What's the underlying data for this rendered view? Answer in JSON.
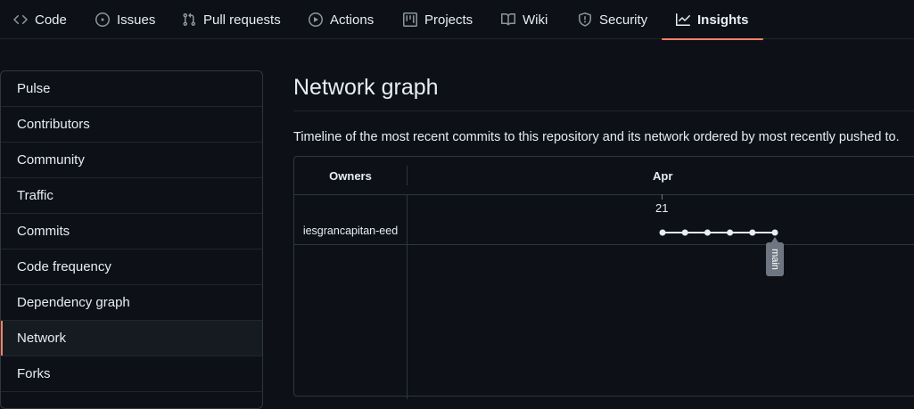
{
  "repo_nav": {
    "tabs": [
      {
        "label": "Code",
        "icon": "code-icon"
      },
      {
        "label": "Issues",
        "icon": "issue-icon"
      },
      {
        "label": "Pull requests",
        "icon": "pull-request-icon"
      },
      {
        "label": "Actions",
        "icon": "play-icon"
      },
      {
        "label": "Projects",
        "icon": "table-icon"
      },
      {
        "label": "Wiki",
        "icon": "book-icon"
      },
      {
        "label": "Security",
        "icon": "shield-icon"
      },
      {
        "label": "Insights",
        "icon": "graph-icon",
        "active": true
      }
    ]
  },
  "sidebar": {
    "items": [
      {
        "label": "Pulse"
      },
      {
        "label": "Contributors"
      },
      {
        "label": "Community"
      },
      {
        "label": "Traffic"
      },
      {
        "label": "Commits"
      },
      {
        "label": "Code frequency"
      },
      {
        "label": "Dependency graph"
      },
      {
        "label": "Network",
        "selected": true
      },
      {
        "label": "Forks"
      }
    ]
  },
  "main": {
    "title": "Network graph",
    "description": "Timeline of the most recent commits to this repository and its network ordered by most recently pushed to."
  },
  "network": {
    "owners_header": "Owners",
    "month": "Apr",
    "day": "21",
    "owner": "iesgrancapitan-eed",
    "commit_count": 6,
    "branch": "main"
  },
  "colors": {
    "background": "#0d1117",
    "accent": "#f78166",
    "border": "#30363d",
    "commit": "#e6edf3"
  }
}
